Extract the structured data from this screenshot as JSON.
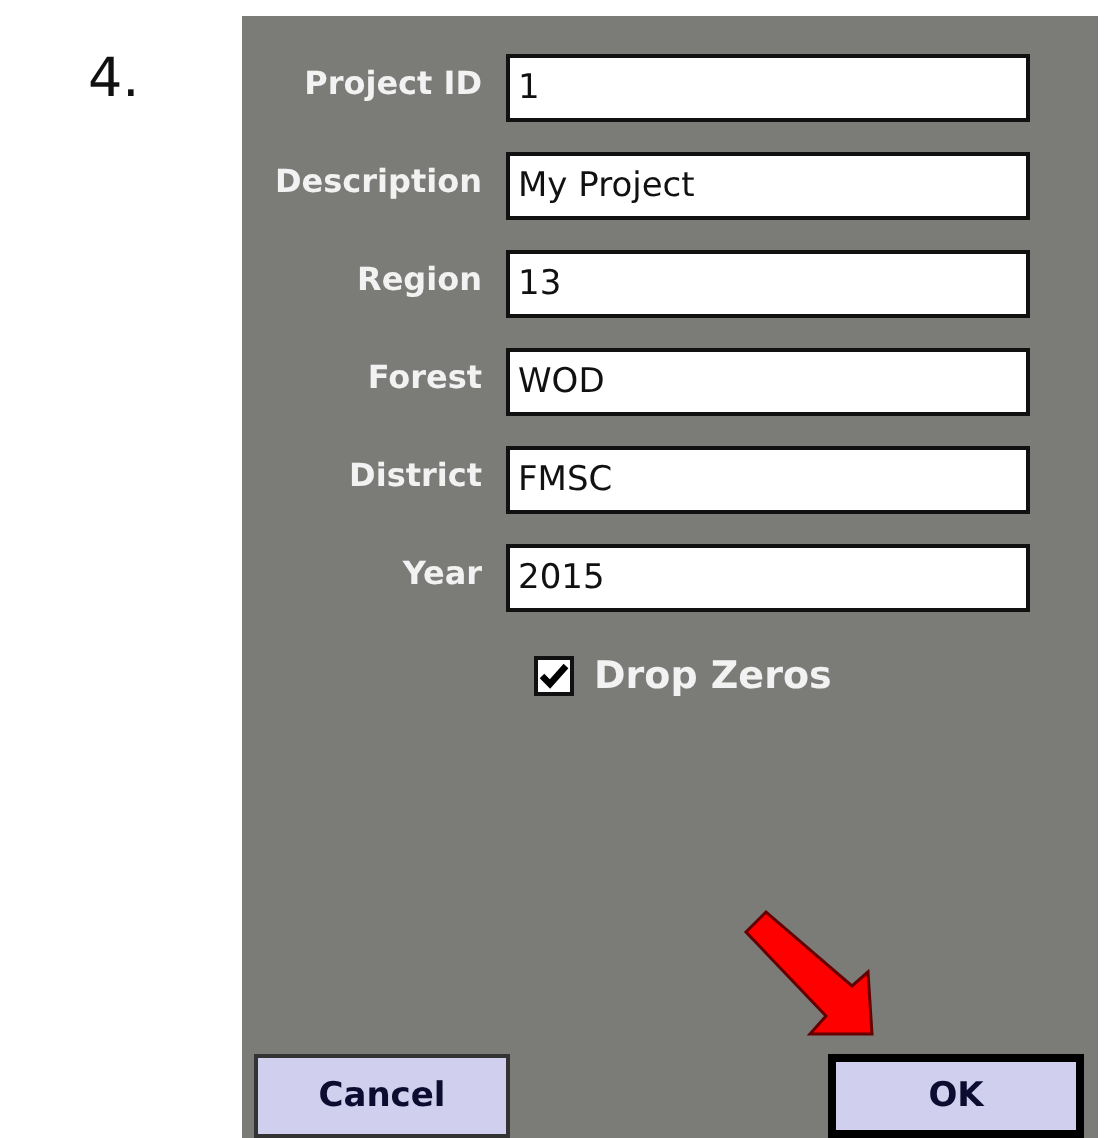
{
  "step": "4.",
  "fields": [
    {
      "label": "Project ID",
      "value": "1"
    },
    {
      "label": "Description",
      "value": "My Project"
    },
    {
      "label": "Region",
      "value": "13"
    },
    {
      "label": "Forest",
      "value": "WOD"
    },
    {
      "label": "District",
      "value": "FMSC"
    },
    {
      "label": "Year",
      "value": "2015"
    }
  ],
  "drop_zeros": {
    "label": "Drop Zeros",
    "checked": true
  },
  "buttons": [
    {
      "label": "Cancel",
      "default": false
    },
    {
      "label": "OK",
      "default": true
    }
  ]
}
